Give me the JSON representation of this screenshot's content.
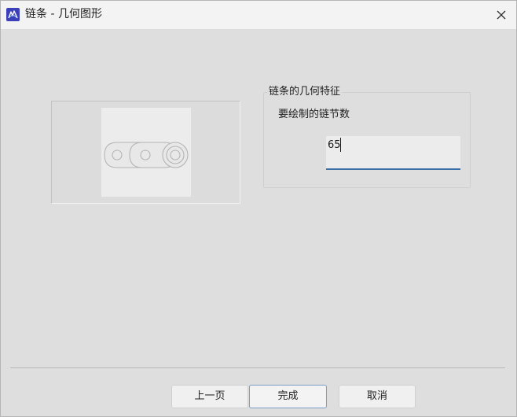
{
  "window": {
    "title": "链条 - 几何图形"
  },
  "icons": {
    "app": "app-logo-icon",
    "close": "close-icon"
  },
  "group": {
    "title": "链条的几何特征",
    "field_label": "要绘制的链节数",
    "field_value": "65"
  },
  "buttons": {
    "prev": "上一页",
    "finish": "完成",
    "cancel": "取消"
  },
  "colors": {
    "accent": "#3a6ea8",
    "app_icon": "#3b3fb8"
  }
}
